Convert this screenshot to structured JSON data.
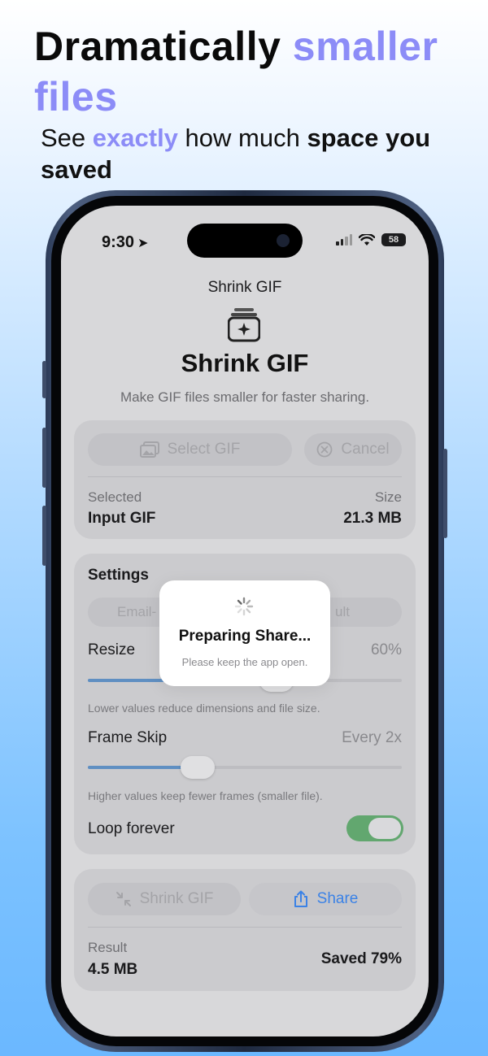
{
  "promo": {
    "headline_part1": "Dramatically ",
    "headline_accent": "smaller files",
    "sub_part1": "See ",
    "sub_accent": "exactly",
    "sub_part2": " how much ",
    "sub_bold": "space you saved",
    "accent_color": "#8c8cf7"
  },
  "status_bar": {
    "time": "9:30",
    "battery": "58"
  },
  "nav": {
    "title": "Shrink GIF"
  },
  "hero": {
    "title": "Shrink GIF",
    "subtitle": "Make GIF files smaller for faster sharing."
  },
  "input_card": {
    "select_label": "Select GIF",
    "cancel_label": "Cancel",
    "selected_caption": "Selected",
    "selected_value": "Input GIF",
    "size_caption": "Size",
    "size_value": "21.3 MB"
  },
  "settings": {
    "heading": "Settings",
    "segment_left": "Email-",
    "segment_right": "ult",
    "resize_label": "Resize",
    "resize_value": "60%",
    "resize_fraction": 0.6,
    "resize_hint": "Lower values reduce dimensions and file size.",
    "frame_skip_label": "Frame Skip",
    "frame_skip_value": "Every 2x",
    "frame_skip_fraction": 0.35,
    "frame_skip_hint": "Higher values keep fewer frames (smaller file).",
    "loop_label": "Loop forever",
    "loop_on": true,
    "toggle_color": "#62a76f"
  },
  "result_card": {
    "shrink_label": "Shrink GIF",
    "share_label": "Share",
    "share_color": "#3b82e6",
    "result_caption": "Result",
    "result_value": "4.5 MB",
    "saved_value": "Saved 79%"
  },
  "hud": {
    "title": "Preparing Share...",
    "subtitle": "Please keep the app open."
  }
}
